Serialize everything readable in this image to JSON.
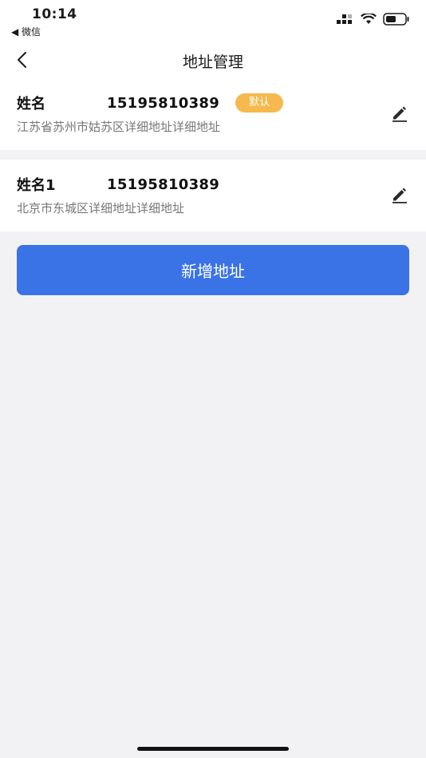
{
  "status_bar": {
    "time": "10:14",
    "back_app": "◀ 微信"
  },
  "nav": {
    "title": "地址管理"
  },
  "addresses": [
    {
      "name": "姓名",
      "phone": "15195810389",
      "badge": "默认",
      "address": "江苏省苏州市姑苏区详细地址详细地址"
    },
    {
      "name": "姓名1",
      "phone": "15195810389",
      "address": "北京市东城区详细地址详细地址"
    }
  ],
  "add_button": {
    "label": "新增地址"
  },
  "colors": {
    "accent": "#3a73e5",
    "badge": "#f5b94d",
    "background": "#f2f2f5"
  }
}
